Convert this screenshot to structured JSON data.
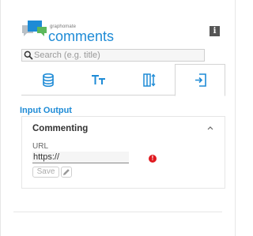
{
  "header": {
    "brand_small": "graphomate",
    "brand_name": "comments",
    "info_label": "i"
  },
  "search": {
    "placeholder": "Search (e.g. title)",
    "value": ""
  },
  "tabs": [
    {
      "name": "data",
      "icon": "database-icon",
      "active": false
    },
    {
      "name": "text",
      "icon": "text-format-icon",
      "active": false
    },
    {
      "name": "layout",
      "icon": "column-sort-icon",
      "active": false
    },
    {
      "name": "input-output",
      "icon": "login-icon",
      "active": true
    }
  ],
  "section": {
    "title": "Input Output"
  },
  "commenting": {
    "title": "Commenting",
    "url_label": "URL",
    "url_value": "https://",
    "error_mark": "!",
    "save_label": "Save"
  },
  "colors": {
    "accent": "#1e8bd6",
    "error": "#e0191f",
    "logo_blue": "#1e8bd6",
    "logo_green": "#5cb85c",
    "logo_gray": "#b9c0c6"
  }
}
